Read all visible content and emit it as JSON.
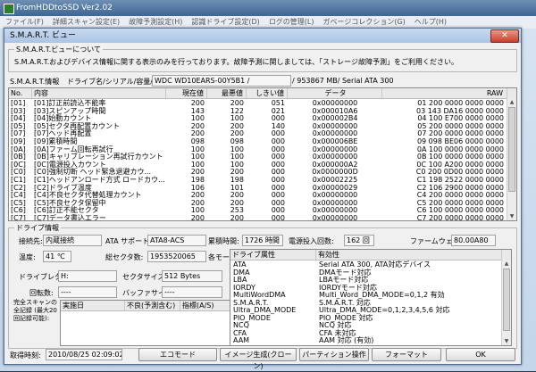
{
  "app": {
    "title": "FromHDDtoSSD Ver2.02",
    "menu": [
      "ファイル(F)",
      "詳細スキャン設定(E)",
      "故障予測設定(H)",
      "認識ドライブ設定(D)",
      "ログの管理(L)",
      "ガベージコレクション(G)",
      "ヘルプ(H)"
    ]
  },
  "dialog": {
    "title": "S.M.A.R.T. ビュー",
    "close_label": "✕",
    "about": {
      "legend": "S.M.A.R.T.ビューについて",
      "text": "S.M.A.R.T.およびデバイス情報に関する表示のみを行っております。故障予測に関しましては、「ストレージ故障予測」をご利用ください。"
    },
    "smart": {
      "label": "S.M.A.R.T.情報",
      "drive_label": "ドライブ名/シリアル/容量/規格:",
      "drive_value": "WDC WD10EARS-00Y5B1 /",
      "drive_value2": "/ 953867 MB/ Serial ATA 300",
      "columns": [
        "No.",
        "内容",
        "現在値",
        "最悪値",
        "しきい値",
        "データ",
        "RAW"
      ],
      "rows": [
        [
          "[01]",
          "[01]訂正前読込不能率",
          "200",
          "200",
          "051",
          "0x00000000",
          "01 200  0000 0000 0000"
        ],
        [
          "[03]",
          "[03]スピンアップ時間",
          "143",
          "122",
          "021",
          "0x000010A6",
          "03 143  DA16 0000 0000"
        ],
        [
          "[04]",
          "[04]始動カウント",
          "100",
          "100",
          "000",
          "0x000002B4",
          "04 100  E700 0000 0000"
        ],
        [
          "[05]",
          "[05]セクタ再配置カウント",
          "200",
          "200",
          "140",
          "0x00000000",
          "05 200  0000 0000 0000"
        ],
        [
          "[07]",
          "[07]ヘッド再配置",
          "200",
          "200",
          "000",
          "0x00000000",
          "07 200  0000 0000 0000"
        ],
        [
          "[09]",
          "[09]累積時間",
          "098",
          "098",
          "000",
          "0x000006BE",
          "09 098  BE06 0000 0000"
        ],
        [
          "[0A]",
          "[0A]ファーム回転再試行",
          "100",
          "100",
          "000",
          "0x00000000",
          "0A 100  0000 0000 0000"
        ],
        [
          "[0B]",
          "[0B]キャリブレーション再試行カウント",
          "100",
          "100",
          "000",
          "0x00000000",
          "0B 100  0000 0000 0000"
        ],
        [
          "[0C]",
          "[0C]電源投入カウント",
          "100",
          "100",
          "000",
          "0x000000A2",
          "0C 100  A200 0000 0000"
        ],
        [
          "[C0]",
          "[C0]強制切断 ヘッド緊急退避カウ...",
          "200",
          "200",
          "000",
          "0x0000000D",
          "C0 200  0D00 0000 0000"
        ],
        [
          "[C1]",
          "[C1]ヘッドアンロード方式 ロードカウ...",
          "198",
          "198",
          "000",
          "0x00002225",
          "C1 198  2522 0000 0000"
        ],
        [
          "[C2]",
          "[C2]ドライブ温度",
          "106",
          "101",
          "000",
          "0x00000029",
          "C2 106  2900 0000 0000"
        ],
        [
          "[C4]",
          "[C4]不良セクタ代替処理カウント",
          "200",
          "200",
          "000",
          "0x00000000",
          "C4 200  0000 0000 0000"
        ],
        [
          "[C5]",
          "[C5]不良セクタ保留中",
          "200",
          "200",
          "000",
          "0x00000000",
          "C5 200  0000 0000 0000"
        ],
        [
          "[C6]",
          "[C6]訂正不能セクタ",
          "100",
          "253",
          "000",
          "0x00000000",
          "C6 100  0000 0000 0000"
        ],
        [
          "[C7]",
          "[C7]データ書込エラー",
          "200",
          "200",
          "000",
          "0x00000000",
          "C7 200  0000 0000 0000"
        ]
      ]
    },
    "drive_info": {
      "legend": "ドライブ情報",
      "connection_label": "接続先:",
      "connection_value": "内蔵接続",
      "ata_label": "ATA サポート:",
      "ata_value": "ATA8-ACS",
      "hours_label": "累積時間:",
      "hours_value": "1726 時間",
      "power_label": "電源投入回数:",
      "power_value": "162 回",
      "firmware_label": "ファームウェア:",
      "firmware_value": "80.00A80",
      "temp_label": "温度:",
      "temp_value": "41 ℃",
      "sectors_label": "総セクタ数:",
      "sectors_value": "1953520065",
      "mode_label": "各モード:",
      "letter_label": "ドライブレター:",
      "letter_value": "H:",
      "sector_size_label": "セクタサイズ:",
      "sector_size_value": "512 Bytes",
      "rpm_label": "回転数:",
      "rpm_value": "----",
      "buffer_label": "バッファサイズ:",
      "buffer_value": "----",
      "scan_label": "完全スキャンの全記録 (最大20回記録可能):",
      "scan_columns": [
        "実施日",
        "不良(予測含む)",
        "指標(A/S)"
      ],
      "feature_columns": [
        "ドライブ属性",
        "有効性"
      ],
      "features": [
        [
          "ATA",
          "Serial ATA 300, ATA対応デバイス"
        ],
        [
          "DMA",
          "DMAモード対応"
        ],
        [
          "LBA",
          "LBAモード対応"
        ],
        [
          "IORDY",
          "IORDYモード対応"
        ],
        [
          "MultiWordDMA",
          "Multi_Word_DMA_MODE=0,1,2 有効"
        ],
        [
          "S.M.A.R.T.",
          "S.M.A.R.T. 対応"
        ],
        [
          "Ultra_DMA_MODE",
          "Ultra_DMA_MODE=0,1,2,3,4,5,6 対応"
        ],
        [
          "PIO_MODE",
          "PIO_MODE 対応"
        ],
        [
          "NCQ",
          "NCQ 対応"
        ],
        [
          "CFA",
          "CFA 未対応"
        ],
        [
          "AAM",
          "AAM 対応 (有効)"
        ]
      ]
    },
    "footer": {
      "date_label": "取得時刻:",
      "date_value": "2010/08/25 02:09:02",
      "eco_button": "エコモード",
      "image_button": "イメージ生成(クローン)",
      "partition_button": "パーティション操作",
      "format_button": "フォーマット",
      "ok_button": "OK"
    }
  }
}
